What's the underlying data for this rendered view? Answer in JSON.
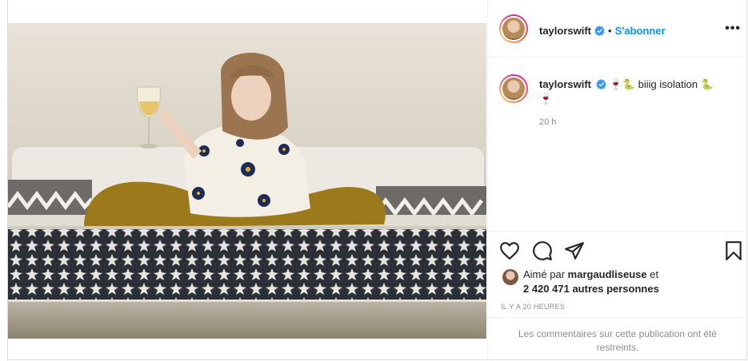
{
  "post": {
    "username": "taylorswift",
    "follow_label": "S'abonner",
    "separator": "•",
    "more_label": "•••",
    "caption": {
      "username": "taylorswift",
      "text_before": "🍷🐍 biiig isolation 🐍",
      "text_after": "🍷"
    },
    "caption_time": "20 h",
    "likes": {
      "prefix": "Aimé par",
      "user": "margaudliseuse",
      "and": "et",
      "count": "2 420 471 autres personnes"
    },
    "timestamp": "IL Y A 20 HEURES",
    "comments_restricted": "Les commentaires sur cette publication ont été restreints."
  },
  "icons": {
    "verified": "verified-badge-icon",
    "like": "heart-icon",
    "comment": "comment-bubble-icon",
    "share": "paper-plane-icon",
    "save": "bookmark-icon",
    "more": "more-options-icon"
  },
  "colors": {
    "accent": "#0095f6",
    "text": "#262626",
    "muted": "#8e8e8e",
    "border": "#dbdbdb"
  }
}
